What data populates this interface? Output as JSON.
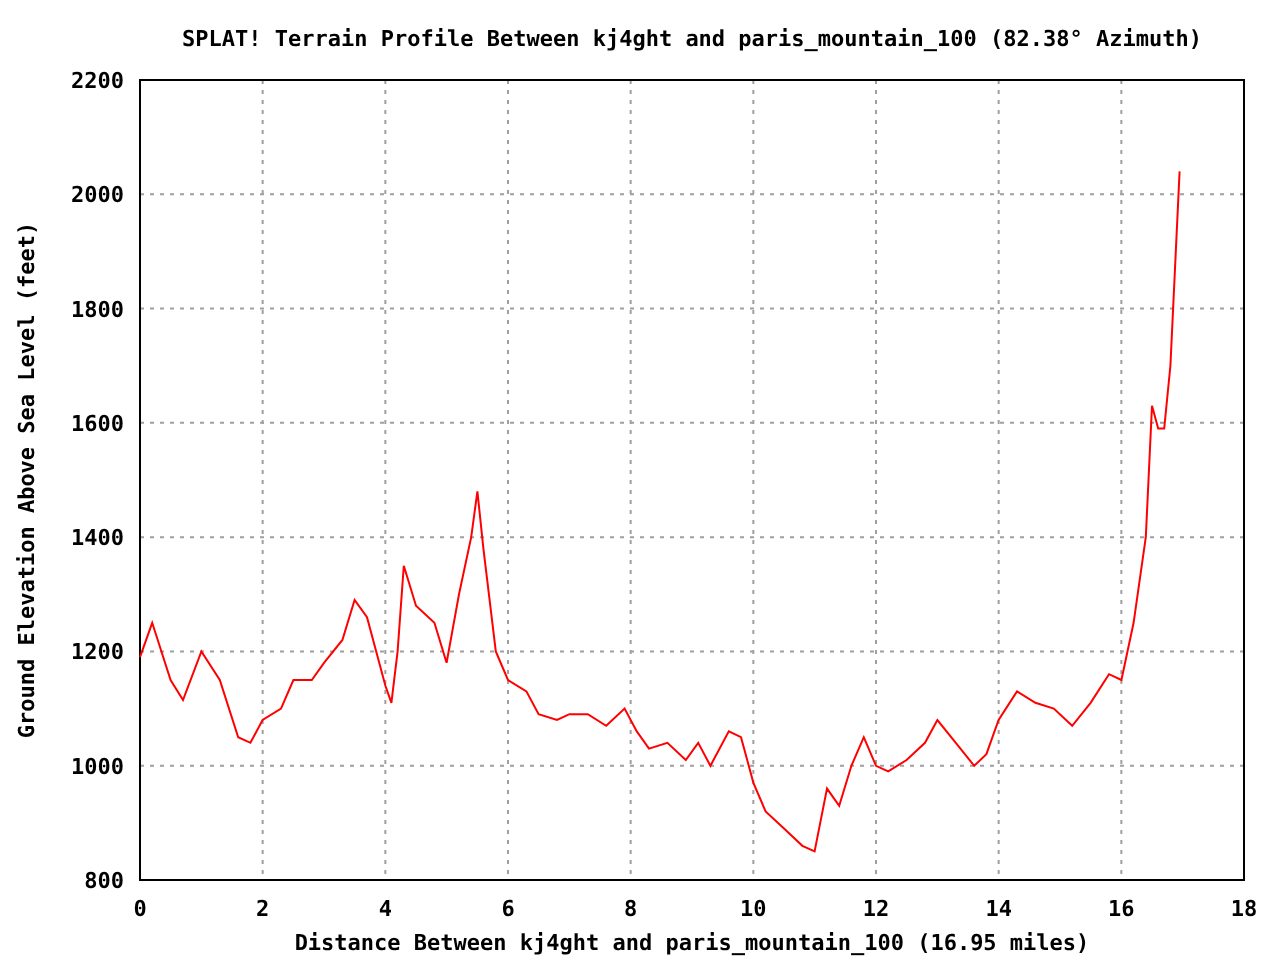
{
  "chart_data": {
    "type": "line",
    "title": "SPLAT! Terrain Profile Between kj4ght and paris_mountain_100 (82.38° Azimuth)",
    "xlabel": "Distance Between kj4ght and paris_mountain_100 (16.95 miles)",
    "ylabel": "Ground Elevation Above Sea Level (feet)",
    "x": [
      0,
      0.2,
      0.5,
      0.7,
      1.0,
      1.3,
      1.6,
      1.8,
      2.0,
      2.3,
      2.5,
      2.8,
      3.0,
      3.3,
      3.5,
      3.7,
      4.0,
      4.1,
      4.2,
      4.3,
      4.5,
      4.8,
      5.0,
      5.2,
      5.4,
      5.5,
      5.6,
      5.8,
      6.0,
      6.3,
      6.5,
      6.8,
      7.0,
      7.3,
      7.6,
      7.9,
      8.1,
      8.3,
      8.6,
      8.9,
      9.1,
      9.3,
      9.6,
      9.8,
      10.0,
      10.2,
      10.5,
      10.8,
      11.0,
      11.2,
      11.4,
      11.6,
      11.8,
      12.0,
      12.2,
      12.5,
      12.8,
      13.0,
      13.3,
      13.6,
      13.8,
      14.0,
      14.3,
      14.6,
      14.9,
      15.2,
      15.5,
      15.8,
      16.0,
      16.2,
      16.4,
      16.5,
      16.6,
      16.7,
      16.8,
      16.95
    ],
    "series": [
      {
        "color": "#ff0000",
        "values": [
          1190,
          1250,
          1150,
          1115,
          1200,
          1150,
          1050,
          1040,
          1080,
          1100,
          1150,
          1150,
          1180,
          1220,
          1290,
          1260,
          1140,
          1110,
          1200,
          1350,
          1280,
          1250,
          1180,
          1300,
          1400,
          1480,
          1380,
          1200,
          1150,
          1130,
          1090,
          1080,
          1090,
          1090,
          1070,
          1100,
          1060,
          1030,
          1040,
          1010,
          1040,
          1000,
          1060,
          1050,
          970,
          920,
          890,
          860,
          850,
          960,
          930,
          1000,
          1050,
          1000,
          990,
          1010,
          1040,
          1080,
          1040,
          1000,
          1020,
          1080,
          1130,
          1110,
          1100,
          1070,
          1110,
          1160,
          1150,
          1250,
          1400,
          1630,
          1590,
          1590,
          1700,
          2040
        ]
      }
    ],
    "xlim": [
      0,
      18
    ],
    "ylim": [
      800,
      2200
    ],
    "xticks": [
      0,
      2,
      4,
      6,
      8,
      10,
      12,
      14,
      16,
      18
    ],
    "yticks": [
      800,
      1000,
      1200,
      1400,
      1600,
      1800,
      2000,
      2200
    ],
    "grid": true
  }
}
